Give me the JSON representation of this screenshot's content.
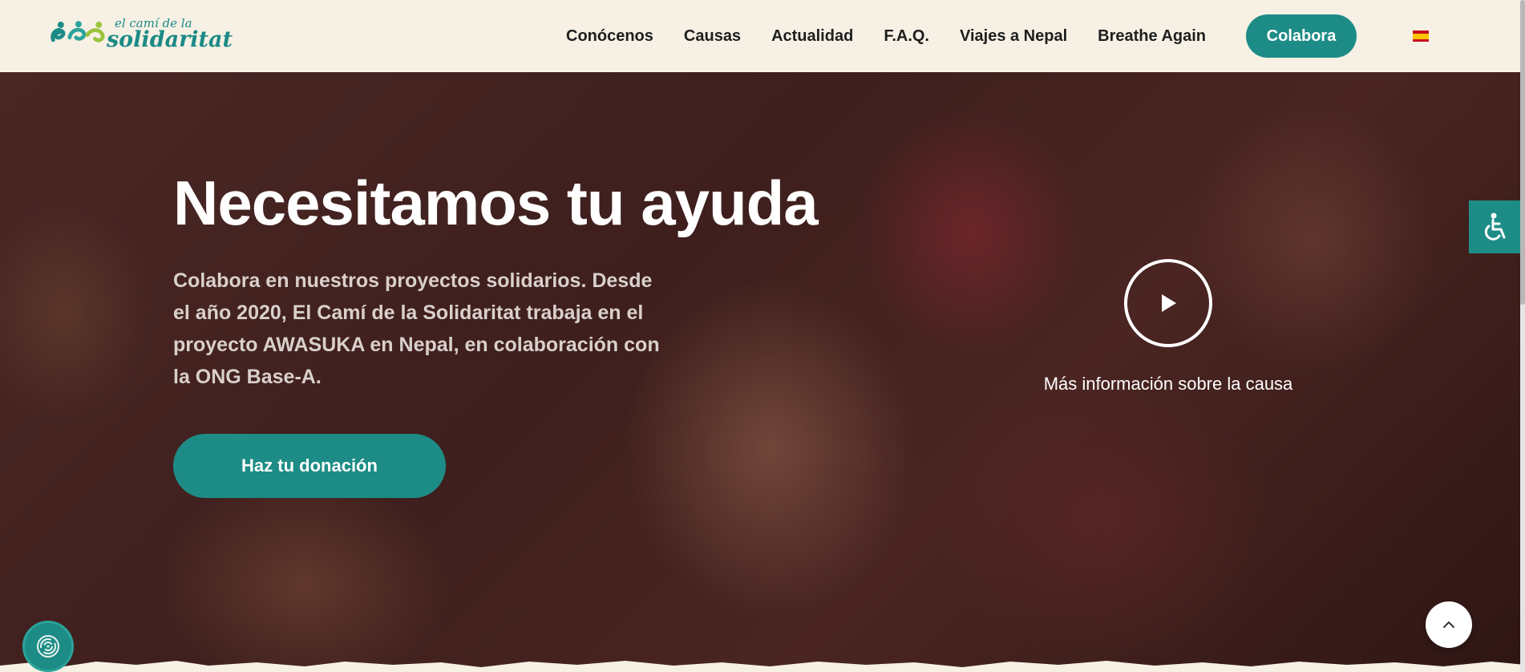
{
  "header": {
    "logo": {
      "line1": "el camí de la",
      "line2": "solidaritat"
    },
    "nav": [
      {
        "label": "Conócenos"
      },
      {
        "label": "Causas"
      },
      {
        "label": "Actualidad"
      },
      {
        "label": "F.A.Q."
      },
      {
        "label": "Viajes a Nepal"
      },
      {
        "label": "Breathe Again"
      }
    ],
    "cta_label": "Colabora",
    "language_icon": "spain-flag-icon"
  },
  "hero": {
    "title": "Necesitamos tu ayuda",
    "description": "Colabora en nuestros proyectos solidarios. Desde el año 2020, El Camí de la Solidaritat trabaja en el proyecto AWASUKA en Nepal, en colaboración con la ONG Base-A.",
    "donate_label": "Haz tu donación",
    "more_info_label": "Más información sobre la causa",
    "play_icon": "play-icon"
  },
  "widgets": {
    "accessibility_icon": "wheelchair-icon",
    "scroll_top_icon": "chevron-up-icon",
    "cookie_icon": "fingerprint-icon"
  },
  "colors": {
    "brand_teal": "#1e8c86",
    "header_bg": "#f6f1e4",
    "nav_text": "#1e1e1e"
  }
}
